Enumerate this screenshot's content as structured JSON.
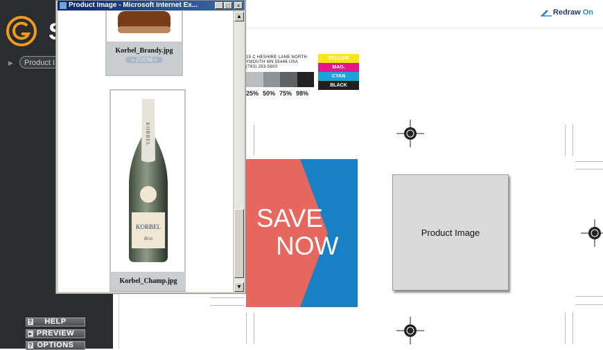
{
  "sidebar": {
    "brand_letter": "S",
    "product_pill": "Product I",
    "buttons": [
      {
        "label": "HELP",
        "icon": "question-icon"
      },
      {
        "label": "PREVIEW",
        "icon": "preview-icon"
      },
      {
        "label": "OPTIONS",
        "icon": "options-icon"
      }
    ]
  },
  "toolbar": {
    "redraw_label": "Redraw",
    "redraw_state": "On"
  },
  "popup": {
    "title": "Product Image - Microsoft Internet Ex...",
    "items": [
      {
        "filename": "Korbel_Brandy.jpg",
        "zoom_label": "» ZOOM «"
      },
      {
        "filename": "Korbel_Champ.jpg"
      }
    ],
    "bottle_label_text": "KORBEL",
    "bottle_neck_text": "KORBEL"
  },
  "canvas": {
    "address_lines": [
      "15 C HESHIRE LANE NORTH",
      "YMOUTH MN 55446 USA",
      "(763) 253-5800"
    ],
    "gray_levels": [
      "25%",
      "50%",
      "75%",
      "98%"
    ],
    "cmyk": [
      {
        "label": "YELLOW",
        "bg": "#f7e51d",
        "fg": "#ffffff"
      },
      {
        "label": "MAG.",
        "bg": "#e3178a",
        "fg": "#ffffff"
      },
      {
        "label": "CYAN",
        "bg": "#1ba3dc",
        "fg": "#ffffff"
      },
      {
        "label": "BLACK",
        "bg": "#231f20",
        "fg": "#ffffff"
      }
    ],
    "save_line1": "SAVE",
    "save_line2": "NOW",
    "product_placeholder": "Product Image"
  },
  "colors": {
    "sidebar_bg": "#2a2d2f",
    "accent_orange": "#f39a1e",
    "save_red": "#e5675d",
    "save_blue": "#1a80c4"
  }
}
